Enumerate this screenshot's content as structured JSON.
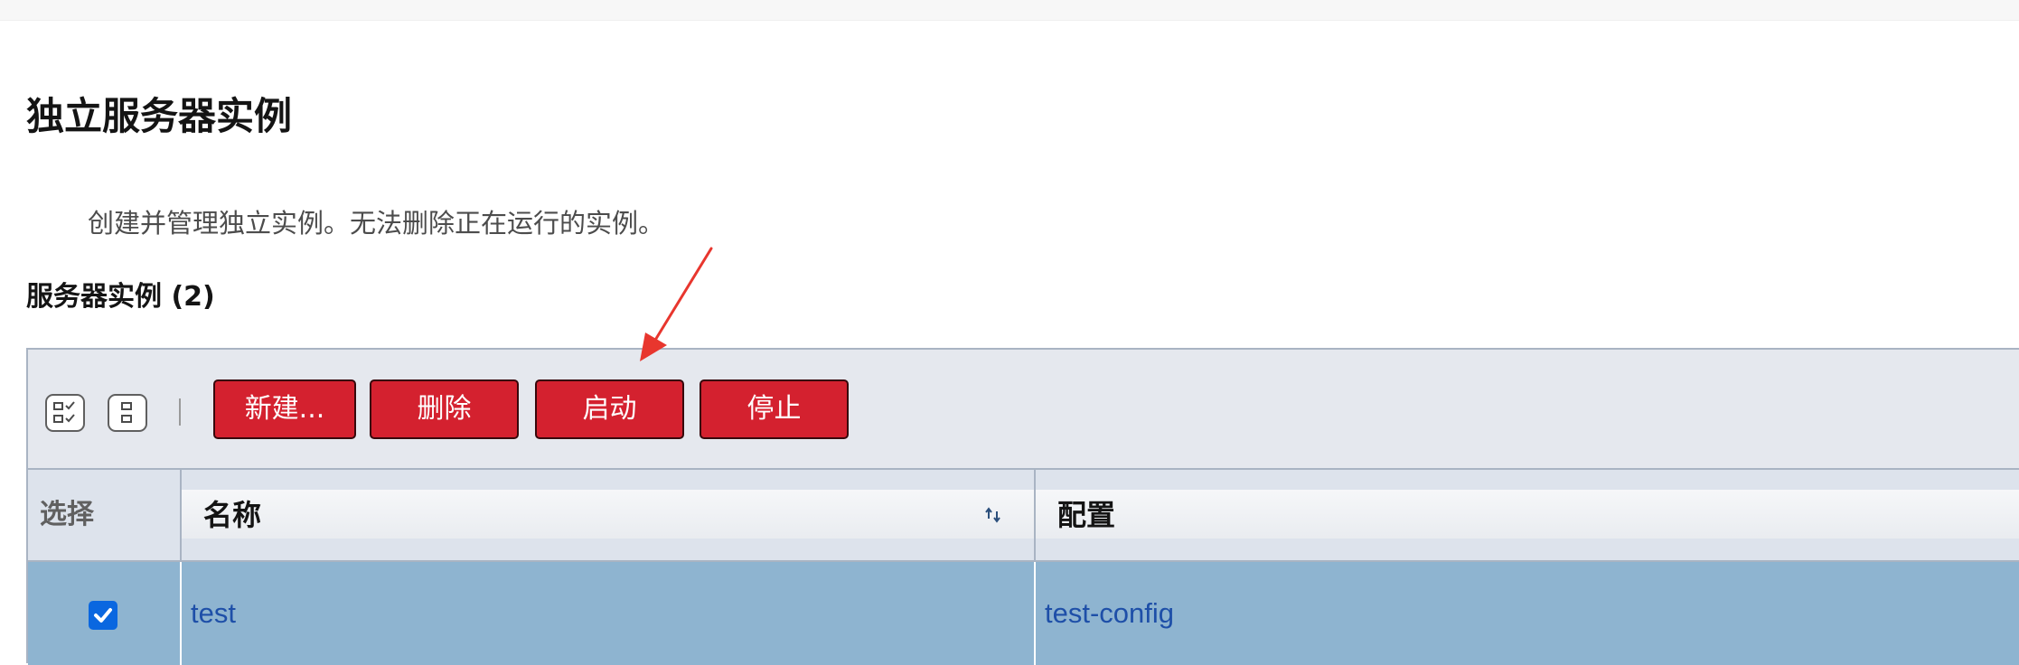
{
  "page": {
    "title": "独立服务器实例",
    "description": "创建并管理独立实例。无法删除正在运行的实例。",
    "section_title": "服务器实例 (2)"
  },
  "toolbar": {
    "select_all_icon": "select-all-icon",
    "deselect_all_icon": "deselect-all-icon",
    "new_label": "新建...",
    "delete_label": "删除",
    "start_label": "启动",
    "stop_label": "停止",
    "button_color": "#d4212f"
  },
  "table": {
    "columns": [
      {
        "label": "选择"
      },
      {
        "label": "名称",
        "sortable": true
      },
      {
        "label": "配置"
      }
    ],
    "rows": [
      {
        "selected": true,
        "name": "test",
        "config": "test-config"
      }
    ],
    "selected_row_color": "#8eb4d0",
    "link_color": "#1e4fa8"
  },
  "annotation": {
    "icon": "red-arrow-annotation",
    "color": "#e8362e",
    "points_to": "启动"
  }
}
